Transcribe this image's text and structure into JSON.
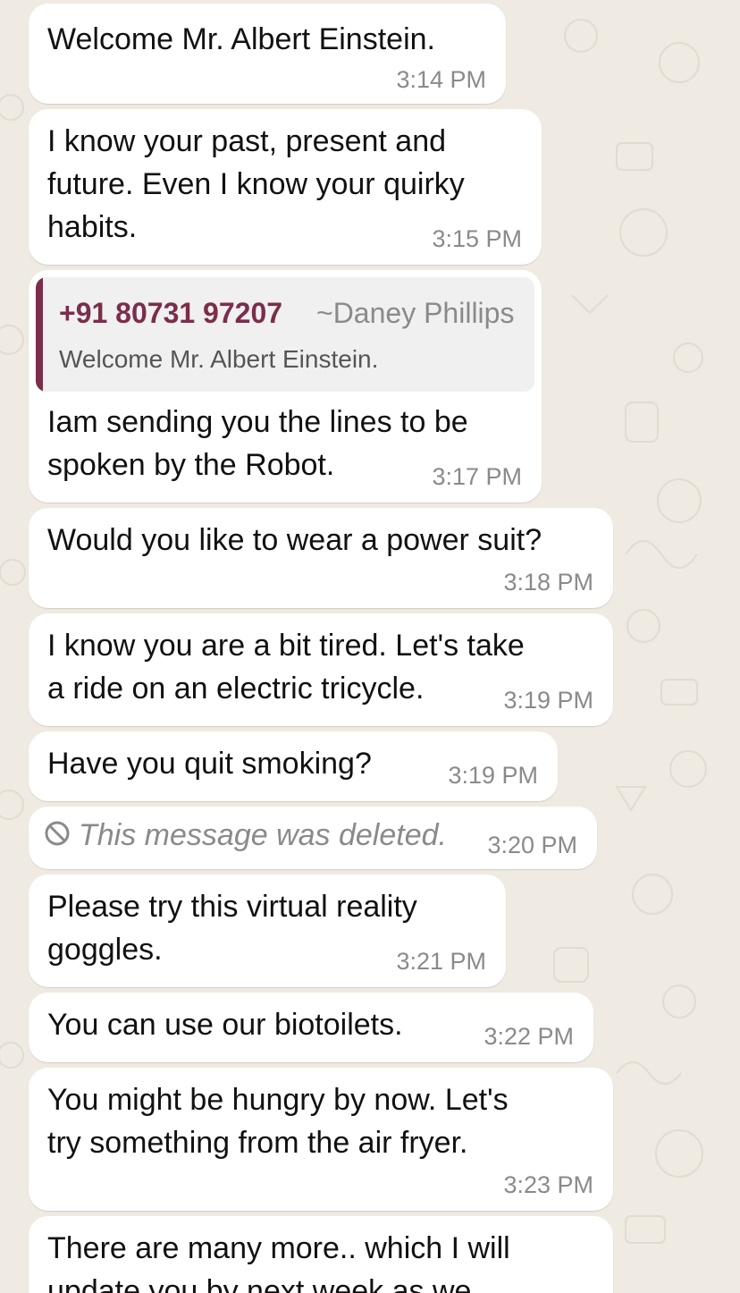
{
  "chat": {
    "messages": [
      {
        "text": "Welcome Mr. Albert Einstein.",
        "time": "3:14 PM"
      },
      {
        "text": "I know your past, present and\nfuture. Even I know your quirky\nhabits.",
        "time": "3:15 PM"
      },
      {
        "quote": {
          "sender_number": "+91 80731 97207",
          "sender_name": "~Daney Phillips",
          "text": "Welcome Mr. Albert Einstein."
        },
        "text": "Iam sending you the lines to be\nspoken by the Robot.",
        "time": "3:17 PM"
      },
      {
        "text": "Would you like to wear a power suit?",
        "time": "3:18 PM"
      },
      {
        "text": "I know you are a bit tired. Let's take\na ride on an electric tricycle.",
        "time": "3:19 PM"
      },
      {
        "text": "Have you quit smoking?",
        "time": "3:19 PM"
      },
      {
        "deleted_text": "This message was deleted.",
        "time": "3:20 PM",
        "icon": "blocked-icon"
      },
      {
        "text": "Please try this virtual reality\ngoggles.",
        "time": "3:21 PM"
      },
      {
        "text": "You can use our biotoilets.",
        "time": "3:22 PM"
      },
      {
        "text": "You might be hungry by now. Let's\ntry something from the air fryer.",
        "time": "3:23 PM"
      },
      {
        "text": "There are many more.. which I will\nupdate you by next week as we"
      }
    ]
  },
  "colors": {
    "background": "#efeae2",
    "bubble": "#ffffff",
    "quote_accent": "#7b2d4a",
    "timestamp": "#8a8a8a"
  }
}
